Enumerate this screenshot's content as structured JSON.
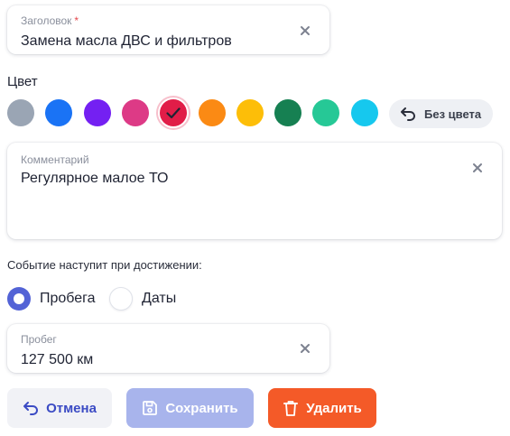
{
  "title_field": {
    "label": "Заголовок",
    "required_mark": "*",
    "value": "Замена масла ДВС и фильтров",
    "clear_icon": "close-icon"
  },
  "color_section": {
    "title": "Цвет",
    "swatches": [
      {
        "color": "#9aa5b4",
        "selected": false
      },
      {
        "color": "#1a73f5",
        "selected": false
      },
      {
        "color": "#7420f2",
        "selected": false
      },
      {
        "color": "#dd3a86",
        "selected": false
      },
      {
        "color": "#e11d48",
        "selected": true
      },
      {
        "color": "#fb8a14",
        "selected": false
      },
      {
        "color": "#fdbe08",
        "selected": false
      },
      {
        "color": "#168052",
        "selected": false
      },
      {
        "color": "#26c896",
        "selected": false
      },
      {
        "color": "#16c8ee",
        "selected": false
      }
    ],
    "no_color_button": {
      "label": "Без цвета",
      "icon": "undo-arrow-icon"
    }
  },
  "comment_field": {
    "label": "Комментарий",
    "value": "Регулярное малое ТО",
    "clear_icon": "close-icon"
  },
  "trigger": {
    "hint": "Событие наступит при достижении:",
    "options": [
      {
        "label": "Пробега",
        "selected": true
      },
      {
        "label": "Даты",
        "selected": false
      }
    ]
  },
  "mileage_field": {
    "label": "Пробег",
    "value": "127 500 км",
    "clear_icon": "close-icon"
  },
  "actions": {
    "cancel": {
      "label": "Отмена",
      "icon": "undo-arrow-icon",
      "color": "#3b4bc4",
      "background": "#f1f2f6"
    },
    "save": {
      "label": "Сохранить",
      "icon": "floppy-disk-icon",
      "color": "#ffffff",
      "background": "#a8b4ec",
      "disabled": true
    },
    "delete": {
      "label": "Удалить",
      "icon": "trash-icon",
      "color": "#ffffff",
      "background": "#f45a28"
    }
  },
  "colors": {
    "accent": "#5363d6",
    "text": "#1f2333",
    "muted": "#8a8f9c"
  }
}
